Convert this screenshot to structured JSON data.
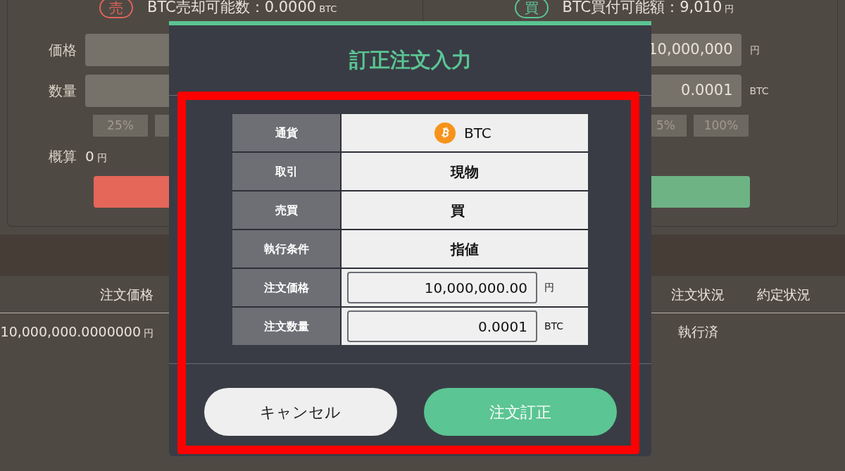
{
  "sell_panel": {
    "badge": "売",
    "available": "BTC売却可能数：0.0000",
    "available_unit": "BTC",
    "fields": [
      {
        "label": "価格"
      },
      {
        "label": "数量"
      }
    ],
    "percent_buttons": [
      "25%"
    ],
    "estimate": {
      "label": "概算",
      "value": "0",
      "unit": "円"
    }
  },
  "buy_panel": {
    "badge": "買",
    "available": "BTC買付可能額：9,010",
    "available_unit": "円",
    "fields": [
      {
        "value": "10,000,000",
        "unit": "円"
      },
      {
        "value": "0.0001",
        "unit": "BTC"
      }
    ],
    "percent_buttons": [
      "5%",
      "100%"
    ]
  },
  "orders_table": {
    "columns": [
      {
        "label": "注文価格"
      },
      {
        "label": "注文状況"
      },
      {
        "label": "約定状況"
      }
    ],
    "rows": [
      {
        "price": "10,000,000.0000000",
        "price_unit": "円",
        "order_status": "執行済"
      }
    ]
  },
  "modal": {
    "title": "訂正注文入力",
    "details": [
      {
        "kind": "currency",
        "label": "通貨",
        "value": "BTC"
      },
      {
        "kind": "text",
        "label": "取引",
        "value": "現物"
      },
      {
        "kind": "text",
        "label": "売買",
        "value": "買"
      },
      {
        "kind": "text",
        "label": "執行条件",
        "value": "指値"
      },
      {
        "kind": "input",
        "label": "注文価格",
        "value": "10,000,000.00",
        "unit": "円"
      },
      {
        "kind": "input",
        "label": "注文数量",
        "value": "0.0001",
        "unit": "BTC"
      }
    ],
    "buttons": [
      {
        "kind": "secondary",
        "label": "キャンセル"
      },
      {
        "kind": "primary",
        "label": "注文訂正"
      }
    ]
  }
}
